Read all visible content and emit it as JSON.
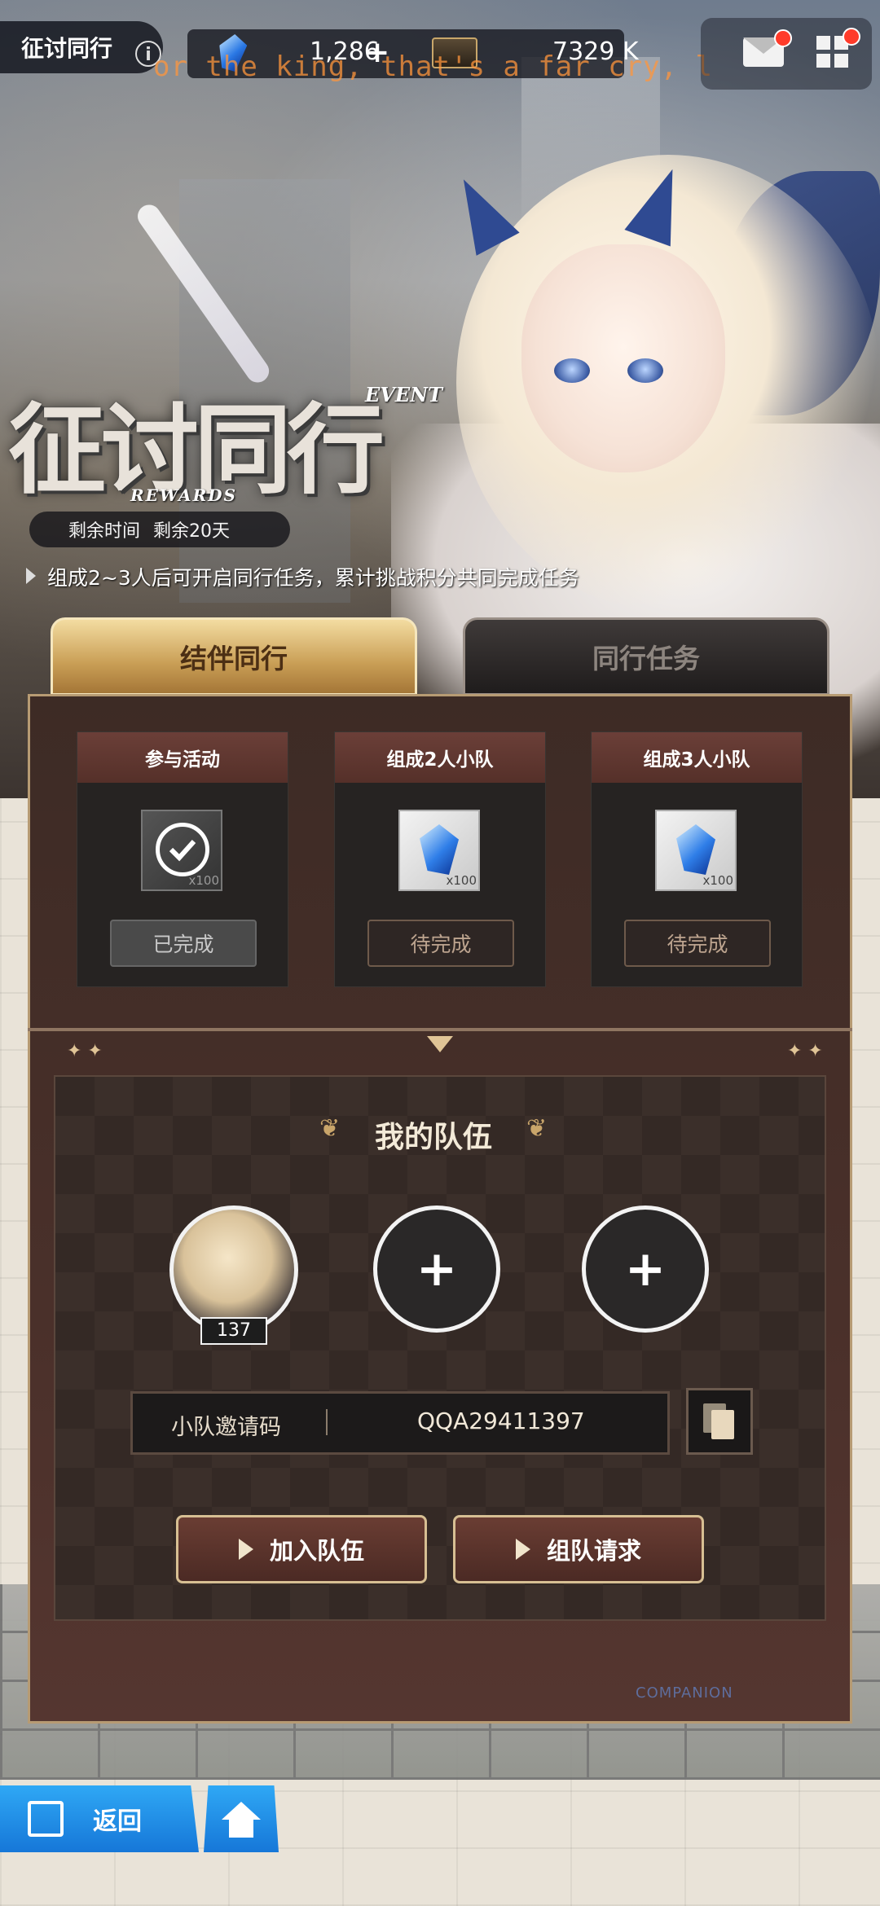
{
  "header": {
    "title": "征讨同行",
    "gem_count": "1,286",
    "gold_count": "7329 K",
    "overlay_text": "or the king, that's a far cry, l"
  },
  "event": {
    "logo_text": "征讨同行",
    "logo_event": "EVENT",
    "logo_rewards": "REWARDS",
    "remaining_label": "剩余时间",
    "remaining_value": "剩余20天",
    "description": "组成2~3人后可开启同行任务，累计挑战积分共同完成任务"
  },
  "tabs": [
    {
      "label": "结伴同行",
      "active": true
    },
    {
      "label": "同行任务",
      "active": false
    }
  ],
  "rewards": [
    {
      "title": "参与活动",
      "qty": "x100",
      "status": "已完成",
      "icon": "checkmark-icon"
    },
    {
      "title": "组成2人小队",
      "qty": "x100",
      "status": "待完成",
      "icon": "crystal-icon"
    },
    {
      "title": "组成3人小队",
      "qty": "x100",
      "status": "待完成",
      "icon": "crystal-icon"
    }
  ],
  "team": {
    "title": "我的队伍",
    "member_level": "137",
    "add_symbol": "+",
    "invite_label": "小队邀请码",
    "invite_code": "QQA29411397",
    "join_button": "加入队伍",
    "request_button": "组队请求"
  },
  "footer": {
    "watermark": "COMPANION",
    "back_label": "返回"
  },
  "colors": {
    "accent_blue": "#1f8fe8",
    "tab_gold": "#c99e55",
    "panel_brown": "#4a302a"
  }
}
